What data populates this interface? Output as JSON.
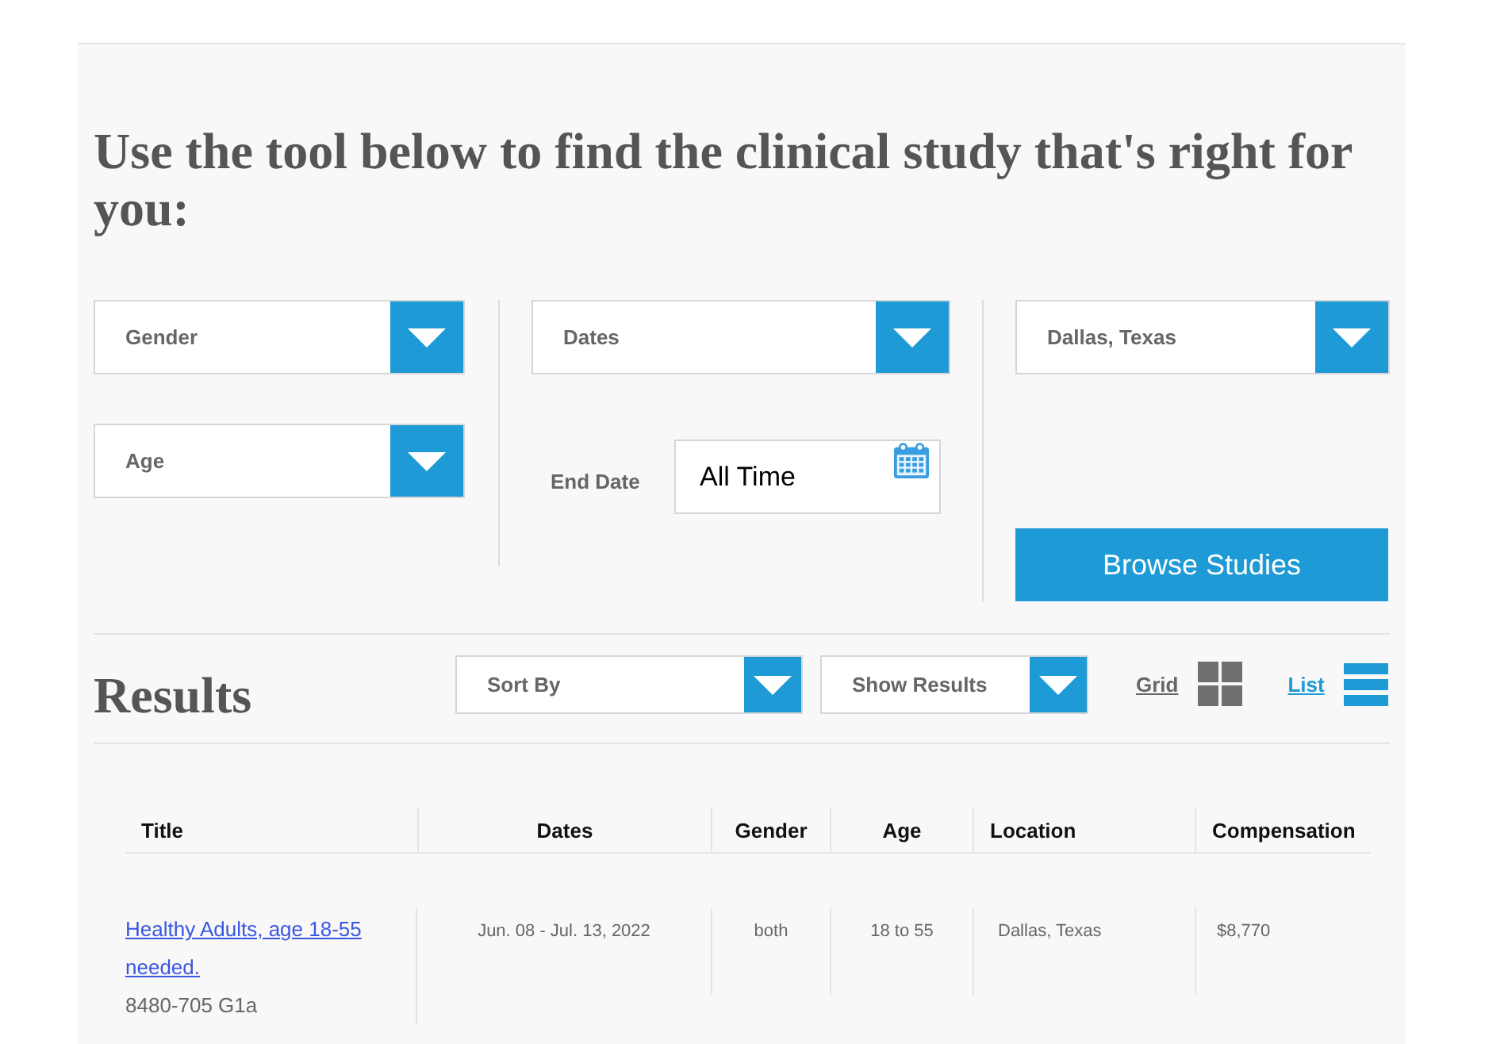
{
  "heading": "Use the tool below to find the clinical study that's right for you:",
  "filter_columns": [
    {
      "items": [
        {
          "kind": "dropdown",
          "label": "Gender"
        },
        {
          "kind": "dropdown",
          "label": "Age"
        }
      ]
    },
    {
      "items": [
        {
          "kind": "dropdown",
          "label": "Dates"
        },
        {
          "kind": "date",
          "label": "End Date",
          "value": "All Time"
        }
      ]
    },
    {
      "items": [
        {
          "kind": "dropdown",
          "label": "Dallas, Texas"
        },
        {
          "kind": "button",
          "label": "Browse Studies"
        }
      ]
    }
  ],
  "results": {
    "heading": "Results",
    "dropdowns": [
      {
        "label": "Sort By"
      },
      {
        "label": "Show Results"
      }
    ],
    "views": [
      {
        "kind": "grid",
        "label": "Grid",
        "selected": false
      },
      {
        "kind": "list",
        "label": "List",
        "selected": true
      }
    ]
  },
  "table": {
    "columns": [
      "Title",
      "Dates",
      "Gender",
      "Age",
      "Location",
      "Compensation"
    ],
    "rows": [
      {
        "cells": [
          {
            "text": "Healthy Adults, age 18-55 needed.",
            "subtext": "8480-705 G1a"
          },
          {
            "text": "Jun. 08 - Jul. 13, 2022"
          },
          {
            "text": "both"
          },
          {
            "text": "18 to 55"
          },
          {
            "text": "Dallas, Texas"
          },
          {
            "text": "$8,770"
          }
        ]
      }
    ]
  }
}
